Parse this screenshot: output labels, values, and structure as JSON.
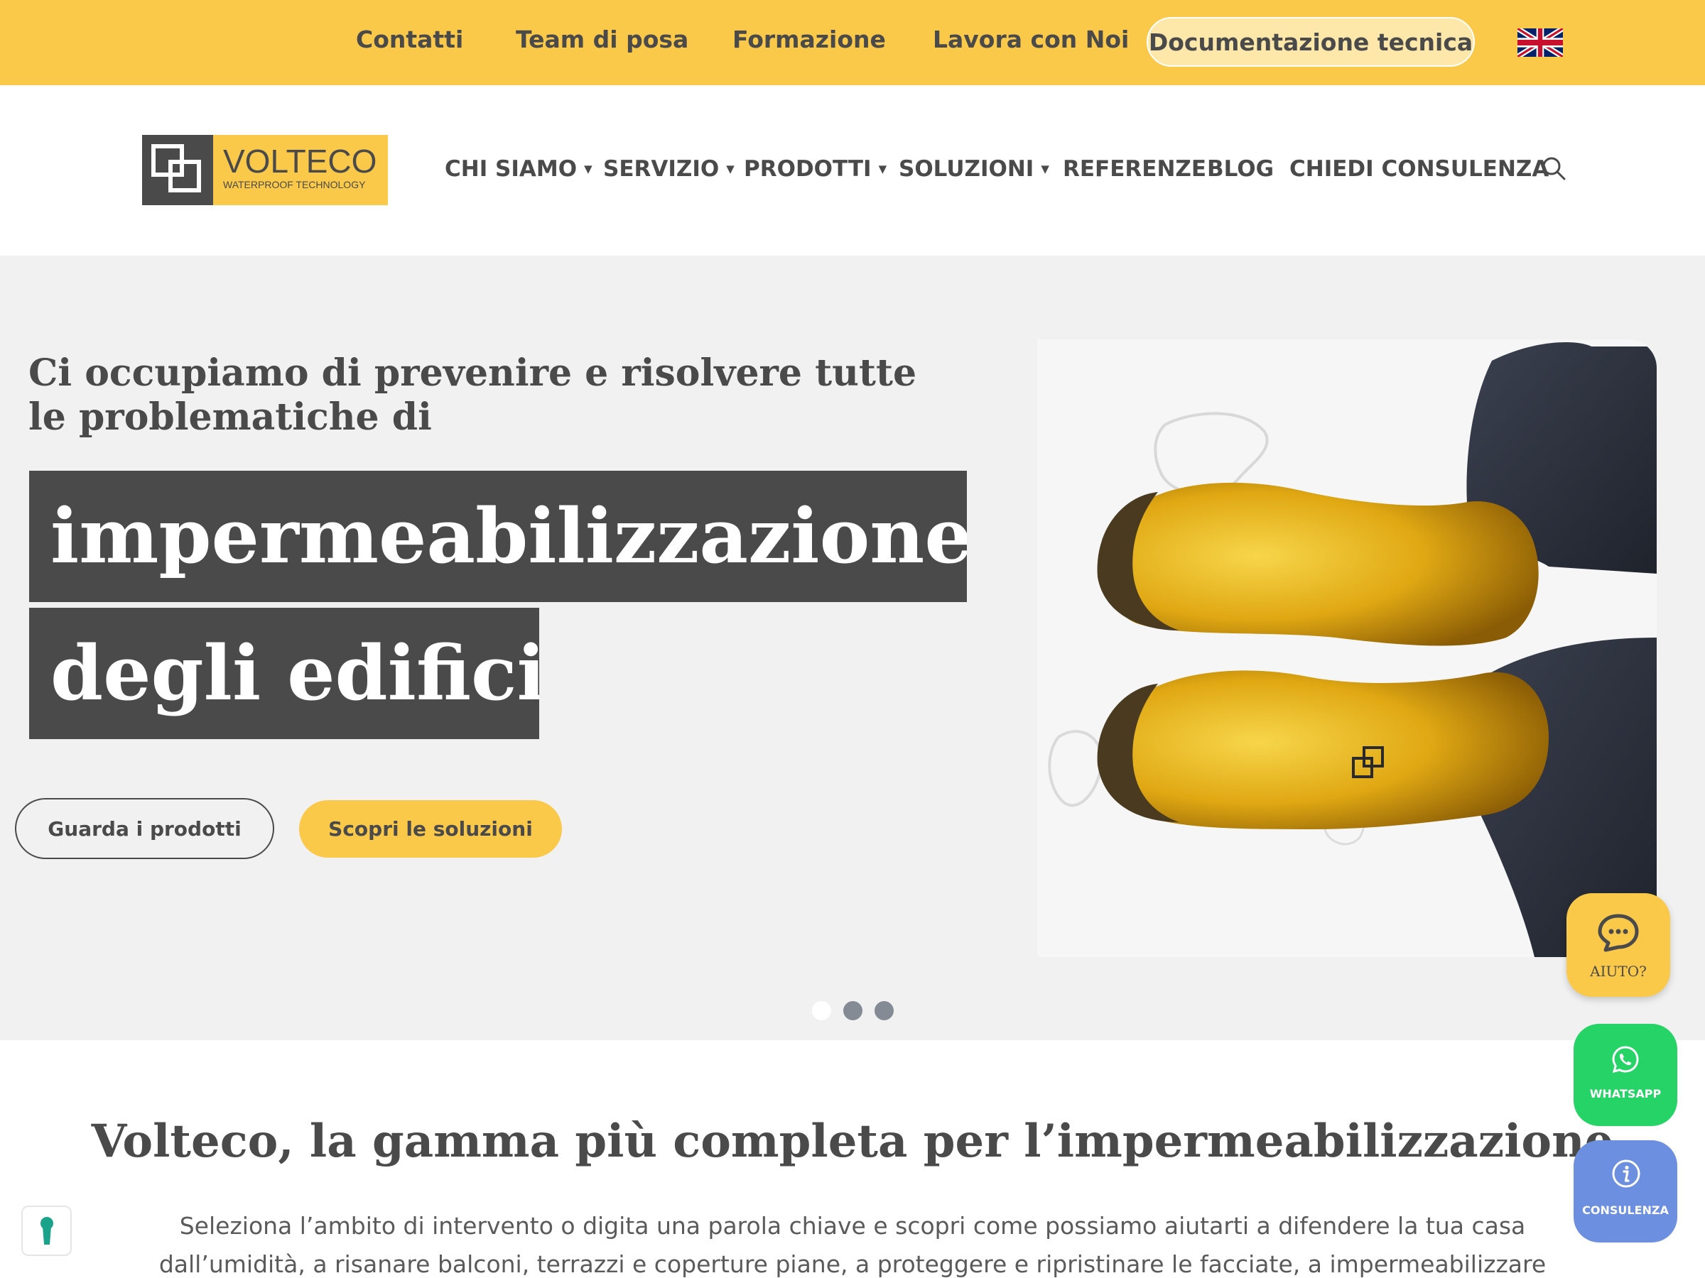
{
  "topbar": {
    "links": [
      "Contatti",
      "Team di posa",
      "Formazione",
      "Lavora con Noi"
    ],
    "doc_button": "Documentazione tecnica",
    "language_flag": "uk-flag-icon"
  },
  "logo": {
    "name": "VOLTECO",
    "tagline": "WATERPROOF TECHNOLOGY"
  },
  "nav": {
    "items": [
      {
        "label": "CHI SIAMO",
        "dropdown": true
      },
      {
        "label": "SERVIZIO",
        "dropdown": true
      },
      {
        "label": "PRODOTTI",
        "dropdown": true
      },
      {
        "label": "SOLUZIONI",
        "dropdown": true
      },
      {
        "label": "REFERENZE",
        "dropdown": false
      },
      {
        "label": "BLOG",
        "dropdown": false
      },
      {
        "label": "CHIEDI CONSULENZA",
        "dropdown": false
      }
    ],
    "caret": "▼",
    "search_icon": "search-icon"
  },
  "hero": {
    "subtitle": "Ci occupiamo di prevenire e risolvere tutte le problematiche di",
    "highlight_line1": "impermeabilizzazione",
    "highlight_line2": "degli edifici",
    "button_products": "Guarda i prodotti",
    "button_solutions": "Scopri le soluzioni",
    "slides": {
      "count": 3,
      "active": 1
    }
  },
  "section": {
    "title": "Volteco, la gamma più completa per l’impermeabilizzazione",
    "text": "Seleziona l’ambito di intervento o digita una parola chiave e scopri come possiamo aiutarti a difendere la tua casa dall’umidità, a risanare balconi, terrazzi e coperture piane, a proteggere e ripristinare le facciate, a impermeabilizzare gli interrati o a garantire il"
  },
  "widgets": {
    "help_label": "AIUTO?",
    "whatsapp_label": "WHATSAPP",
    "consulenza_label": "CONSULENZA"
  },
  "colors": {
    "brand_yellow": "#fbc94a",
    "dark_gray": "#4a4a4a",
    "hero_bg": "#f1f1f1",
    "whatsapp_green": "#25d366",
    "consulenza_blue": "#6c8fe0"
  }
}
